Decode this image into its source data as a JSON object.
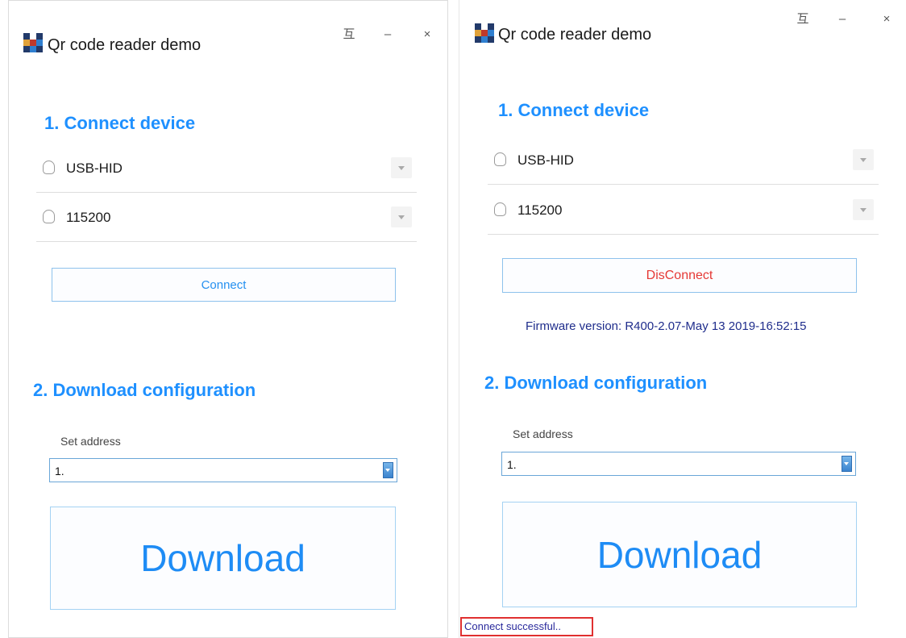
{
  "left": {
    "title": "Qr code reader demo",
    "controls": {
      "pin": "互",
      "minimize": "–",
      "close": "×"
    },
    "step1_heading": "1. Connect device",
    "device_type": "USB-HID",
    "baud_rate": "115200",
    "connect_label": "Connect",
    "step2_heading": "2. Download configuration",
    "address_label": "Set address",
    "address_value": "1.",
    "download_label": "Download"
  },
  "right": {
    "title": "Qr code reader demo",
    "controls": {
      "pin": "互",
      "minimize": "–",
      "close": "×"
    },
    "step1_heading": "1. Connect device",
    "device_type": "USB-HID",
    "baud_rate": "115200",
    "connect_label": "DisConnect",
    "firmware_text": "Firmware version: R400-2.07-May 13 2019-16:52:15",
    "step2_heading": "2. Download configuration",
    "address_label": "Set address",
    "address_value": "1.",
    "download_label": "Download",
    "status_text": "Connect successful.."
  },
  "colors": {
    "heading": "#1e90ff",
    "button_border": "#8ec2ec",
    "disconnect": "#e53935",
    "firmware": "#1f2d8c",
    "status_border": "#e03030"
  }
}
